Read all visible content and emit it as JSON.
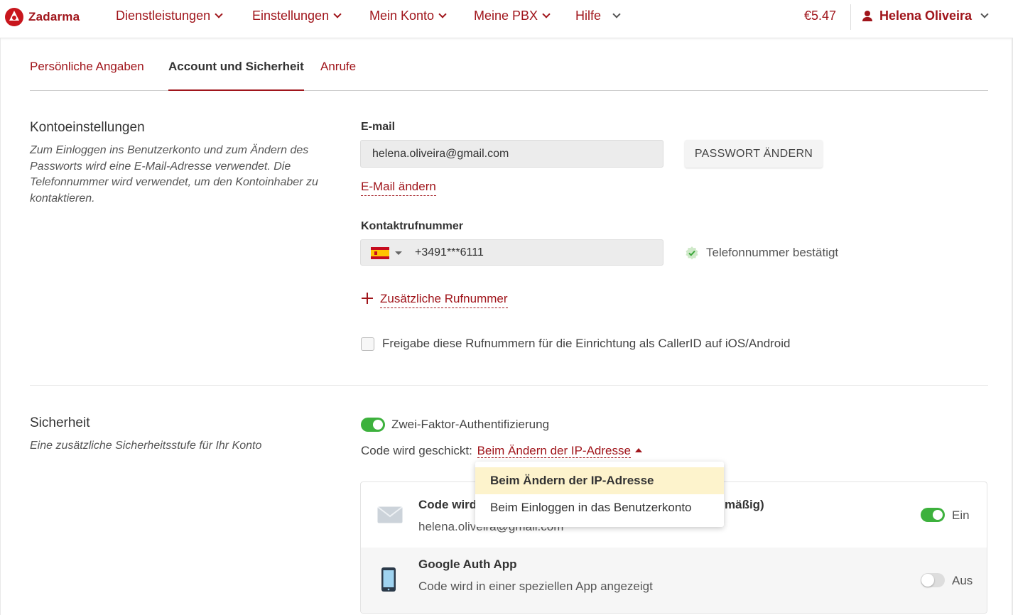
{
  "brand": {
    "name": "Zadarma",
    "accent": "#a0151b"
  },
  "nav": {
    "items": [
      {
        "label": "Dienstleistungen"
      },
      {
        "label": "Einstellungen"
      },
      {
        "label": "Mein Konto"
      },
      {
        "label": "Meine PBX"
      },
      {
        "label": "Hilfe"
      }
    ],
    "balance": "€5.47",
    "user": "Helena Oliveira"
  },
  "tabs": [
    {
      "label": "Persönliche Angaben",
      "active": false
    },
    {
      "label": "Account und Sicherheit",
      "active": true
    },
    {
      "label": "Anrufe",
      "active": false
    }
  ],
  "account": {
    "title": "Kontoeinstellungen",
    "description": "Zum Einloggen ins Benutzerkonto und zum Ändern des Passworts wird eine E-Mail-Adresse verwendet. Die Telefonnummer wird verwendet, um den Kontoinhaber zu kontaktieren.",
    "email_label": "E-mail",
    "email_value": "helena.oliveira@gmail.com",
    "change_password_label": "PASSWORT ÄNDERN",
    "change_email_label": "E-Mail ändern",
    "phone_label": "Kontaktrufnummer",
    "phone_country": "ES",
    "phone_value": "+3491***6111",
    "phone_verified_label": "Telefonnummer bestätigt",
    "add_number_label": "Zusätzliche Rufnummer",
    "callerid_checkbox_label": "Freigabe diese Rufnummern für die Einrichtung als CallerID auf iOS/Android",
    "callerid_checked": false
  },
  "security": {
    "title": "Sicherheit",
    "description": "Eine zusätzliche Sicherheitsstufe für Ihr Konto",
    "two_factor_label": "Zwei-Faktor-Authentifizierung",
    "two_factor_enabled": true,
    "code_sent_prefix": "Code wird geschickt:",
    "code_sent_value": "Beim Ändern der IP-Adresse",
    "dropdown_options": [
      {
        "label": "Beim Ändern der IP-Adresse",
        "selected": true
      },
      {
        "label": "Beim Einloggen in das Benutzerkonto",
        "selected": false
      }
    ],
    "methods": [
      {
        "icon": "envelope-icon",
        "title_start": "Code wird",
        "title_end": "mäßig)",
        "subtitle": "helena.oliveira@gmail.com",
        "enabled": true,
        "state_label": "Ein"
      },
      {
        "icon": "phone-icon",
        "title": "Google Auth App",
        "subtitle": "Code wird in einer speziellen App angezeigt",
        "enabled": false,
        "state_label": "Aus"
      }
    ]
  }
}
